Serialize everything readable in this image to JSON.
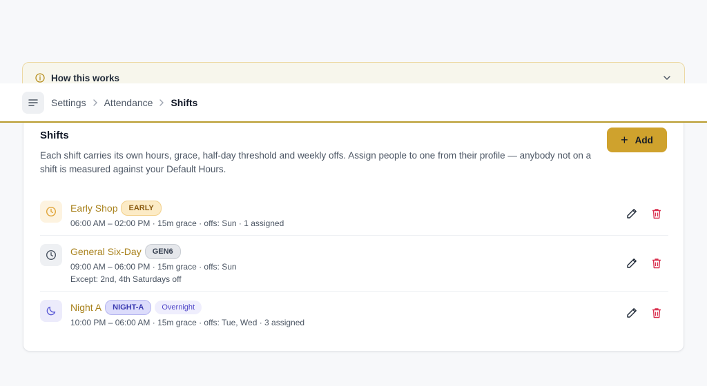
{
  "banner": {
    "title": "How this works"
  },
  "breadcrumb": [
    "Settings",
    "Attendance",
    "Shifts"
  ],
  "card": {
    "title": "Shifts",
    "description": "Each shift carries its own hours, grace, half-day threshold and weekly offs. Assign people to one from their profile — anybody not on a shift is measured against your Default Hours.",
    "add_label": "Add"
  },
  "shifts": [
    {
      "name": "Early Shop",
      "code": "EARLY",
      "tag": null,
      "meta": "06:00 AM – 02:00 PM · 15m grace · offs: Sun · 1 assigned",
      "extra": null,
      "icon": "clock-icon"
    },
    {
      "name": "General Six-Day",
      "code": "GEN6",
      "tag": null,
      "meta": "09:00 AM – 06:00 PM · 15m grace · offs: Sun",
      "extra": "Except: 2nd, 4th Saturdays off",
      "icon": "clock-icon"
    },
    {
      "name": "Night A",
      "code": "NIGHT-A",
      "tag": "Overnight",
      "meta": "10:00 PM – 06:00 AM · 15m grace · offs: Tue, Wed · 3 assigned",
      "extra": null,
      "icon": "moon-icon"
    }
  ],
  "colors": {
    "accent": "#cfa22d",
    "shift_name": "#a8811b",
    "delete": "#d9304f",
    "header_border": "#b89b2c"
  }
}
